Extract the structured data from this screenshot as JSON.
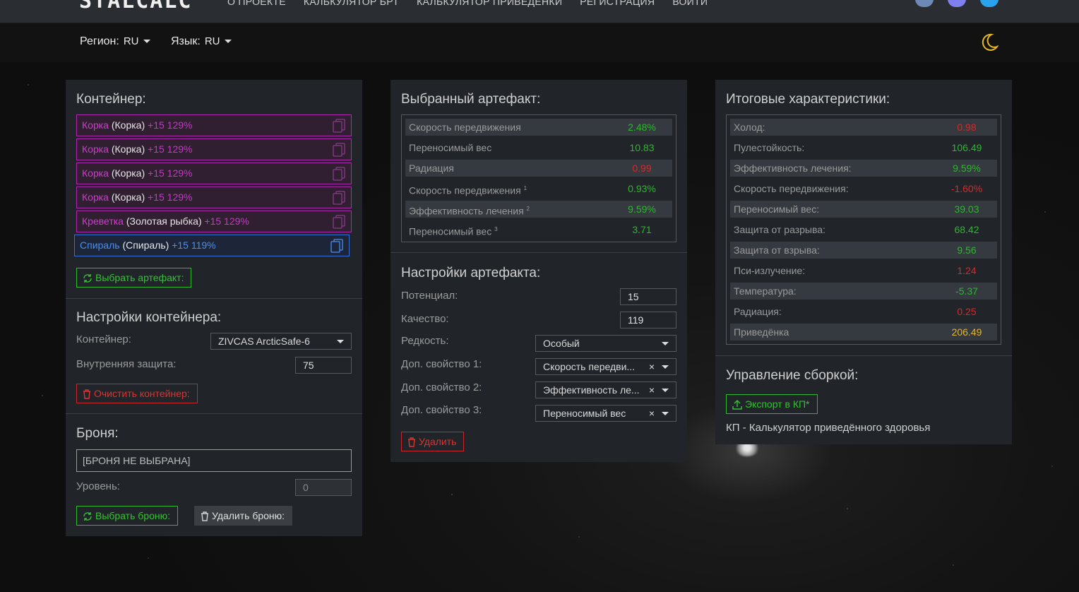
{
  "top": {
    "logo": "STALCALC",
    "nav": [
      "О ПРОЕКТЕ",
      "КАЛЬКУЛЯТОР БРТ",
      "КАЛЬКУЛЯТОР ПРИВЕДЁНКИ",
      "РЕГИСТРАЦИЯ",
      "ВОЙТИ"
    ],
    "socials": [
      "vk-icon",
      "discord-icon",
      "twitter-icon"
    ]
  },
  "subbar": {
    "region_label": "Регион:",
    "region_value": "RU",
    "lang_label": "Язык:",
    "lang_value": "RU",
    "theme_icon": "moon-icon"
  },
  "container_panel": {
    "title": "Контейнер:",
    "slots": [
      {
        "name": "Корка",
        "base": "(Корка)",
        "level": "+15 129%"
      },
      {
        "name": "Корка",
        "base": "(Корка)",
        "level": "+15 129%"
      },
      {
        "name": "Корка",
        "base": "(Корка)",
        "level": "+15 129%"
      },
      {
        "name": "Корка",
        "base": "(Корка)",
        "level": "+15 129%"
      },
      {
        "name": "Креветка",
        "base": "(Золотая рыбка)",
        "level": "+15 129%"
      },
      {
        "name": "Спираль",
        "base": "(Спираль)",
        "level": "+15 119%"
      }
    ],
    "select_artifact_btn": "Выбрать артефакт:",
    "settings_title": "Настройки контейнера:",
    "container_label": "Контейнер:",
    "container_value": "ZIVCAS ArcticSafe-6",
    "inner_protection_label": "Внутренняя защита:",
    "inner_protection_value": "75",
    "clear_btn": "Очистить контейнер:",
    "armor_title": "Броня:",
    "armor_value": "[БРОНЯ НЕ ВЫБРАНА]",
    "level_label": "Уровень:",
    "level_value": "0",
    "select_armor_btn": "Выбрать броню:",
    "delete_armor_btn": "Удалить броню:"
  },
  "artifact_panel": {
    "title": "Выбранный артефакт:",
    "stats": [
      {
        "name": "Скорость передвижения",
        "sup": "",
        "value": "2.48%",
        "tone": "pos"
      },
      {
        "name": "Переносимый вес",
        "sup": "",
        "value": "10.83",
        "tone": "pos"
      },
      {
        "name": "Радиация",
        "sup": "",
        "value": "0.99",
        "tone": "neg"
      },
      {
        "name": "Скорость передвижения",
        "sup": "1",
        "value": "0.93%",
        "tone": "pos"
      },
      {
        "name": "Эффективность лечения",
        "sup": "2",
        "value": "9.59%",
        "tone": "pos"
      },
      {
        "name": "Переносимый вес",
        "sup": "3",
        "value": "3.71",
        "tone": "pos"
      }
    ],
    "settings_title": "Настройки артефакта:",
    "potential_label": "Потенциал:",
    "potential_value": "15",
    "quality_label": "Качество:",
    "quality_value": "119",
    "rarity_label": "Редкость:",
    "rarity_value": "Особый",
    "extra1_label": "Доп. свойство 1:",
    "extra1_value": "Скорость передви...",
    "extra2_label": "Доп. свойство 2:",
    "extra2_value": "Эффективность ле...",
    "extra3_label": "Доп. свойство 3:",
    "extra3_value": "Переносимый вес",
    "clear_x": "×",
    "delete_btn": "Удалить"
  },
  "totals_panel": {
    "title": "Итоговые характеристики:",
    "stats": [
      {
        "name": "Холод:",
        "value": "0.98",
        "tone": "neg"
      },
      {
        "name": "Пулестойкость:",
        "value": "106.49",
        "tone": "pos"
      },
      {
        "name": "Эффективность лечения:",
        "value": "9.59%",
        "tone": "pos"
      },
      {
        "name": "Скорость передвижения:",
        "value": "-1.60%",
        "tone": "neg"
      },
      {
        "name": "Переносимый вес:",
        "value": "39.03",
        "tone": "pos"
      },
      {
        "name": "Защита от разрыва:",
        "value": "68.42",
        "tone": "pos"
      },
      {
        "name": "Защита от взрыва:",
        "value": "9.56",
        "tone": "pos"
      },
      {
        "name": "Пси-излучение:",
        "value": "1.24",
        "tone": "neg"
      },
      {
        "name": "Температура:",
        "value": "-5.37",
        "tone": "pos"
      },
      {
        "name": "Радиация:",
        "value": "0.25",
        "tone": "neg"
      },
      {
        "name": "Приведёнка",
        "value": "206.49",
        "tone": "gold"
      }
    ],
    "build_title": "Управление сборкой:",
    "export_btn": "Экспорт в КП*",
    "note": "КП - Калькулятор приведённого здоровья"
  },
  "colors": {
    "positive": "#2fb52f",
    "negative": "#d42a2a",
    "gold": "#e0b43a",
    "purple": "#d23ad2",
    "blue": "#4b8df0"
  }
}
